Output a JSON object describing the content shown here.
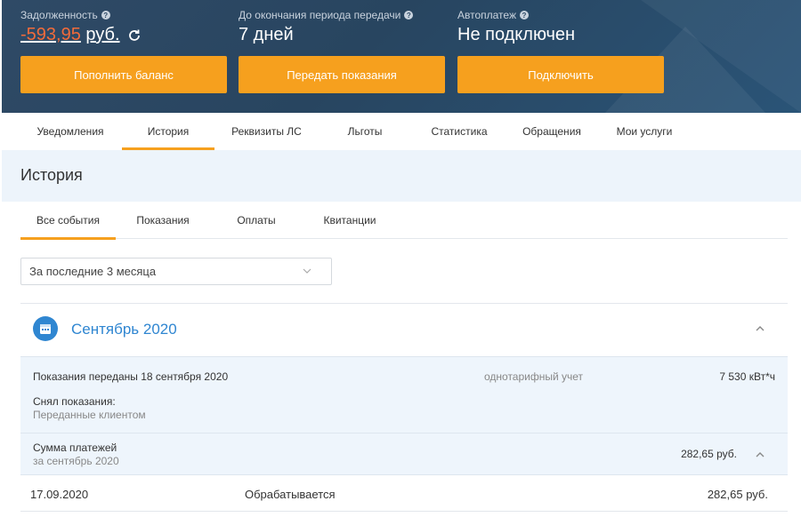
{
  "header": {
    "debt": {
      "label": "Задолженность",
      "amount": "-593,95",
      "currency": "руб."
    },
    "period": {
      "label": "До окончания периода передачи",
      "value": "7 дней"
    },
    "autopay": {
      "label": "Автоплатеж",
      "value": "Не подключен"
    },
    "buttons": {
      "topup": "Пополнить баланс",
      "submit_readings": "Передать показания",
      "connect": "Подключить"
    },
    "colors": {
      "accent": "#f6a01e",
      "debt": "#f26b3a",
      "banner": "#2f4a66"
    }
  },
  "nav": {
    "tabs": [
      "Уведомления",
      "История",
      "Реквизиты ЛС",
      "Льготы",
      "Статистика",
      "Обращения",
      "Мои услуги"
    ],
    "active": "История"
  },
  "page": {
    "title": "История",
    "subtabs": [
      "Все события",
      "Показания",
      "Оплаты",
      "Квитанции"
    ],
    "active_subtab": "Все события",
    "filter": {
      "selected": "За последние 3 месяца"
    }
  },
  "month": {
    "name": "Сентябрь 2020",
    "reading": {
      "title": "Показания переданы 18 сентября 2020",
      "tariff": "однотарифный учет",
      "value": "7 530 кВт*ч",
      "taken_by_label": "Снял показания:",
      "taken_by_value": "Переданные клиентом"
    },
    "payments": {
      "title": "Сумма платежей",
      "subtitle": "за сентябрь 2020",
      "total": "282,65 руб.",
      "rows": [
        {
          "date": "17.09.2020",
          "status": "Обрабатывается",
          "amount": "282,65 руб."
        }
      ]
    }
  }
}
